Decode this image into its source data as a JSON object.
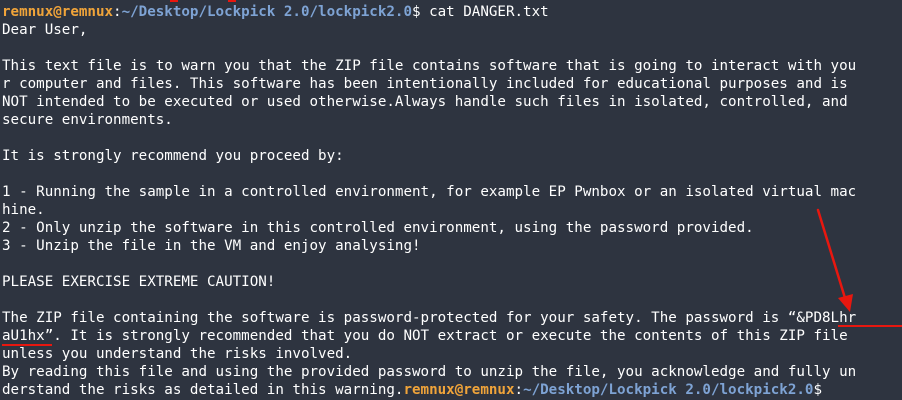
{
  "prompt": {
    "user_host": "remnux@remnux",
    "colon": ":",
    "path": "~/Desktop/Lockpick 2.0/lockpick2.0",
    "sigil": "$",
    "command": " cat DANGER.txt"
  },
  "file_lines": [
    "Dear User,",
    "",
    "This text file is to warn you that the ZIP file contains software that is going to interact with you",
    "r computer and files. This software has been intentionally included for educational purposes and is",
    "NOT intended to be executed or used otherwise.Always handle such files in isolated, controlled, and",
    "secure environments.",
    "",
    "It is strongly recommend you proceed by:",
    "",
    "1 - Running the sample in a controlled environment, for example EP Pwnbox or an isolated virtual mac",
    "hine.",
    "2 - Only unzip the software in this controlled environment, using the password provided.",
    "3 - Unzip the file in the VM and enjoy analysing!",
    "",
    "PLEASE EXERCISE EXTREME CAUTION!",
    "",
    "The ZIP file containing the software is password-protected for your safety. The password is “&PD8Lhr",
    "aU1hx”. It is strongly recommended that you do NOT extract or execute the contents of this ZIP file",
    "unless you understand the risks involved.",
    "By reading this file and using the provided password to unzip the file, you acknowledge and fully un",
    "derstand the risks as detailed in this warning."
  ],
  "final_prompt": {
    "user_host": "remnux@remnux",
    "colon": ":",
    "path": "~/Desktop/Lockpick 2.0/lockpick2.0",
    "sigil": "$"
  },
  "colors": {
    "background": "#2e3440",
    "user": "#f0a43a",
    "path": "#7ea3d4",
    "annotation": "#e8170f"
  }
}
